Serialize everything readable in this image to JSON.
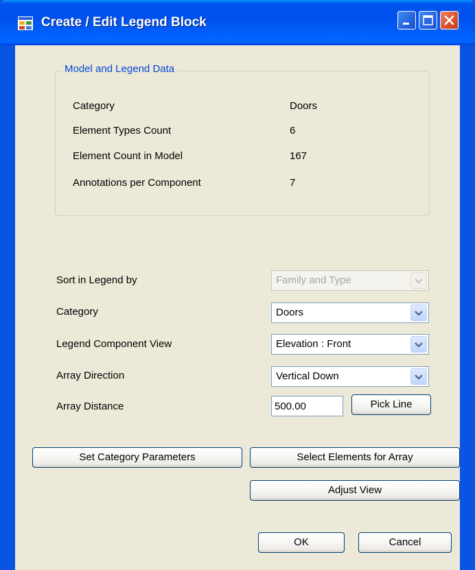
{
  "window": {
    "title": "Create / Edit Legend Block",
    "icon": "app-window-icon"
  },
  "group": {
    "title": "Model and Legend Data",
    "rows": [
      {
        "label": "Category",
        "value": "Doors"
      },
      {
        "label": "Element Types Count",
        "value": "6"
      },
      {
        "label": "Element Count in Model",
        "value": "167"
      },
      {
        "label": "Annotations per Component",
        "value": "7"
      }
    ]
  },
  "form": {
    "sort_label": "Sort in Legend by",
    "sort_value": "Family and Type",
    "category_label": "Category",
    "category_value": "Doors",
    "view_label": "Legend Component View",
    "view_value": "Elevation : Front",
    "direction_label": "Array Direction",
    "direction_value": "Vertical Down",
    "distance_label": "Array Distance",
    "distance_value": "500.00",
    "pick_line_label": "Pick Line"
  },
  "buttons": {
    "set_category": "Set Category Parameters",
    "select_elements": "Select Elements for Array",
    "adjust_view": "Adjust View",
    "ok": "OK",
    "cancel": "Cancel"
  }
}
